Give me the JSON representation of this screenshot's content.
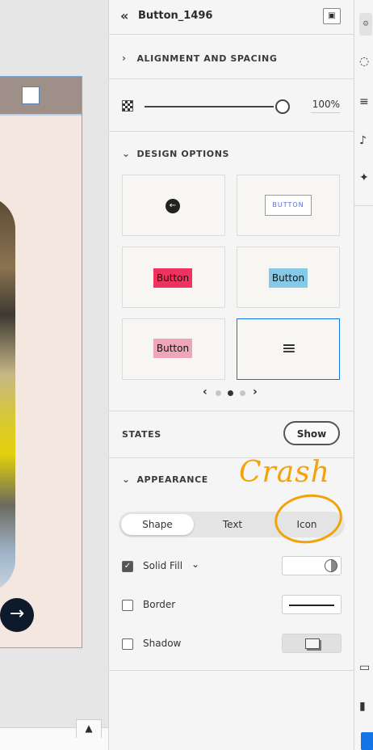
{
  "panel": {
    "back_icon": "chevron-double-left-icon",
    "title": "Button_1496",
    "preview_icon": "preview-icon"
  },
  "alignment": {
    "label": "ALIGNMENT AND SPACING",
    "expanded": false
  },
  "opacity": {
    "value": "100%",
    "level": 1.0
  },
  "design_options": {
    "label": "DESIGN OPTIONS",
    "expanded": true,
    "tiles": [
      {
        "kind": "round-arrow",
        "label": ""
      },
      {
        "kind": "outline",
        "label": "BUTTON",
        "color": "#5a6fd6"
      },
      {
        "kind": "filled",
        "label": "Button",
        "color": "#f0325f"
      },
      {
        "kind": "filled",
        "label": "Button",
        "color": "#86c9e4"
      },
      {
        "kind": "filled",
        "label": "Button",
        "color": "#eea6b8"
      },
      {
        "kind": "menu",
        "label": "≡",
        "selected": true
      }
    ],
    "pager": {
      "prev": "‹",
      "next": "›",
      "pages": 3,
      "current": 2
    }
  },
  "states": {
    "label": "STATES",
    "show_label": "Show"
  },
  "appearance": {
    "label": "APPEARANCE",
    "expanded": true,
    "segments": [
      "Shape",
      "Text",
      "Icon"
    ],
    "active_segment": "Shape",
    "props": [
      {
        "label": "Solid Fill",
        "checked": true,
        "has_dropdown": true
      },
      {
        "label": "Border",
        "checked": false
      },
      {
        "label": "Shadow",
        "checked": false
      }
    ]
  },
  "annotation": {
    "text": "Crash",
    "color": "#f2a20a"
  },
  "canvas": {
    "next_arrow": "→",
    "collapse_caret": "▲"
  },
  "colors": {
    "accent": "#1473e6",
    "panel_bg": "#f5f5f5"
  }
}
